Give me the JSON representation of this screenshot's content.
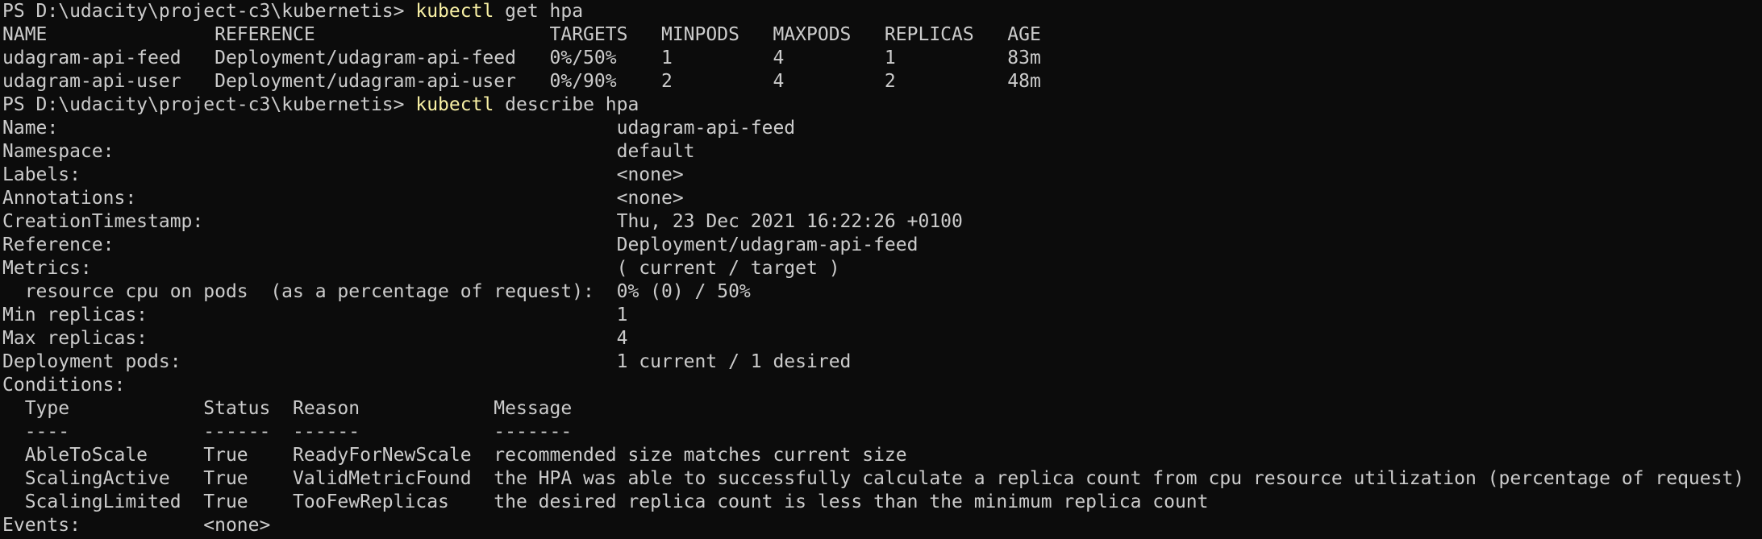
{
  "terminal": {
    "lines": [
      {
        "prompt": "PS D:\\udacity\\project-c3\\kubernetis> ",
        "cmd": "kubectl",
        "args": " get hpa"
      },
      {
        "text": "NAME               REFERENCE                     TARGETS   MINPODS   MAXPODS   REPLICAS   AGE"
      },
      {
        "text": "udagram-api-feed   Deployment/udagram-api-feed   0%/50%    1         4         1          83m"
      },
      {
        "text": "udagram-api-user   Deployment/udagram-api-user   0%/90%    2         4         2          48m"
      },
      {
        "prompt": "PS D:\\udacity\\project-c3\\kubernetis> ",
        "cmd": "kubectl",
        "args": " describe hpa"
      },
      {
        "text": "Name:                                                  udagram-api-feed"
      },
      {
        "text": "Namespace:                                             default"
      },
      {
        "text": "Labels:                                                <none>"
      },
      {
        "text": "Annotations:                                           <none>"
      },
      {
        "text": "CreationTimestamp:                                     Thu, 23 Dec 2021 16:22:26 +0100"
      },
      {
        "text": "Reference:                                             Deployment/udagram-api-feed"
      },
      {
        "text": "Metrics:                                               ( current / target )"
      },
      {
        "text": "  resource cpu on pods  (as a percentage of request):  0% (0) / 50%"
      },
      {
        "text": "Min replicas:                                          1"
      },
      {
        "text": "Max replicas:                                          4"
      },
      {
        "text": "Deployment pods:                                       1 current / 1 desired"
      },
      {
        "text": "Conditions:"
      },
      {
        "text": "  Type            Status  Reason            Message"
      },
      {
        "text": "  ----            ------  ------            -------"
      },
      {
        "text": "  AbleToScale     True    ReadyForNewScale  recommended size matches current size"
      },
      {
        "text": "  ScalingActive   True    ValidMetricFound  the HPA was able to successfully calculate a replica count from cpu resource utilization (percentage of request)"
      },
      {
        "text": "  ScalingLimited  True    TooFewReplicas    the desired replica count is less than the minimum replica count"
      },
      {
        "text": "Events:           <none>"
      }
    ]
  },
  "colors": {
    "background": "#0c0c0c",
    "foreground": "#cccccc",
    "command": "#f9f1a5"
  }
}
